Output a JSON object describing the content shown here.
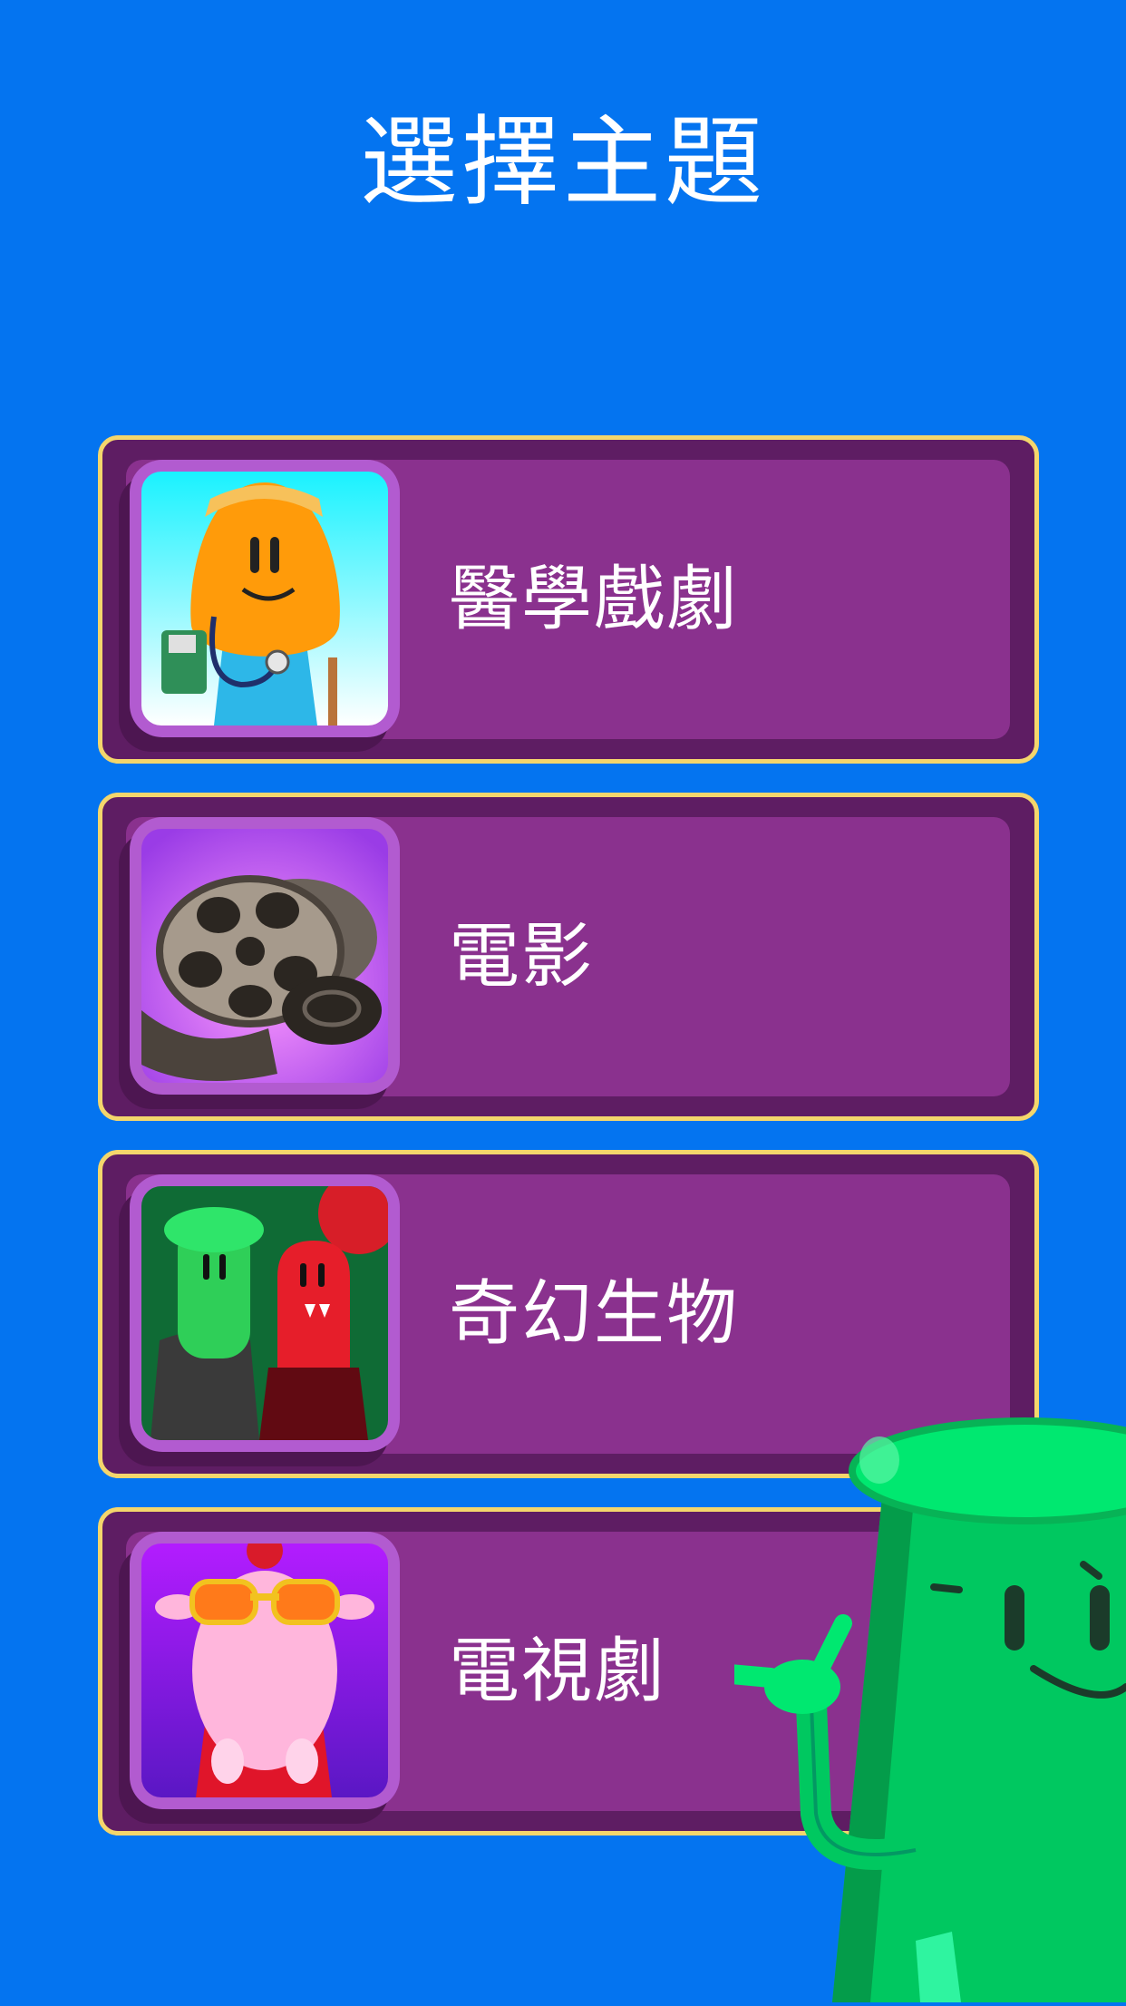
{
  "header": {
    "title": "選擇主題"
  },
  "topics": [
    {
      "label": "醫學戲劇",
      "icon": "doctor-egg-icon"
    },
    {
      "label": "電影",
      "icon": "film-reel-icon"
    },
    {
      "label": "奇幻生物",
      "icon": "monsters-icon"
    },
    {
      "label": "電視劇",
      "icon": "turkey-sunglasses-icon"
    }
  ],
  "mascot": {
    "icon": "green-cup-mascot"
  },
  "colors": {
    "background": "#0474f0",
    "card_border": "#f4d66c",
    "card_outer": "#5e1d63",
    "card_panel": "#8a318e",
    "icon_frame": "#b25bd0",
    "mascot": "#00c860"
  }
}
